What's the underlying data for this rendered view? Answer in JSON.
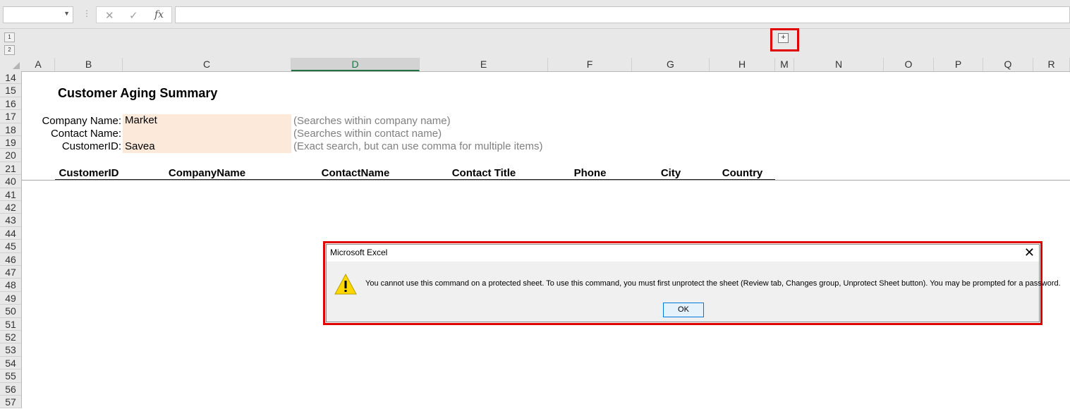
{
  "formula_bar": {
    "name_box_value": "",
    "cancel_glyph": "✕",
    "enter_glyph": "✓",
    "fx_label": "fx",
    "formula_value": ""
  },
  "outline": {
    "levels": [
      "1",
      "2"
    ],
    "expand_button_label": "+"
  },
  "columns": [
    "A",
    "B",
    "C",
    "D",
    "E",
    "F",
    "G",
    "H",
    "M",
    "N",
    "O",
    "P",
    "Q",
    "R"
  ],
  "selected_column": "D",
  "rows": [
    "14",
    "15",
    "16",
    "17",
    "18",
    "19",
    "20",
    "21",
    "40",
    "41",
    "42",
    "43",
    "44",
    "45",
    "46",
    "47",
    "48",
    "49",
    "50",
    "51",
    "52",
    "53",
    "54",
    "55",
    "56",
    "57"
  ],
  "sheet": {
    "title": "Customer Aging Summary",
    "filters": [
      {
        "label": "Company Name:",
        "value": "Market",
        "hint": "(Searches within company name)"
      },
      {
        "label": "Contact Name:",
        "value": "",
        "hint": "(Searches within contact name)"
      },
      {
        "label": "CustomerID:",
        "value": "Savea",
        "hint": "(Exact search, but can use comma for multiple items)"
      }
    ],
    "table_headers": [
      "CustomerID",
      "CompanyName",
      "ContactName",
      "Contact Title",
      "Phone",
      "City",
      "Country"
    ]
  },
  "dialog": {
    "title": "Microsoft Excel",
    "message": "You cannot use this command on a protected sheet. To use this command, you must first unprotect the sheet (Review tab, Changes group, Unprotect Sheet button). You may be prompted for a password.",
    "ok_label": "OK",
    "close_glyph": "✕"
  },
  "colors": {
    "input_fill": "#fde9d9",
    "highlight": "#e00000",
    "selected_column_accent": "#217346",
    "warning_yellow": "#ffd700"
  },
  "icons": [
    "dropdown-arrow-icon",
    "cancel-icon",
    "enter-icon",
    "fx-icon",
    "warning-icon",
    "close-icon"
  ]
}
